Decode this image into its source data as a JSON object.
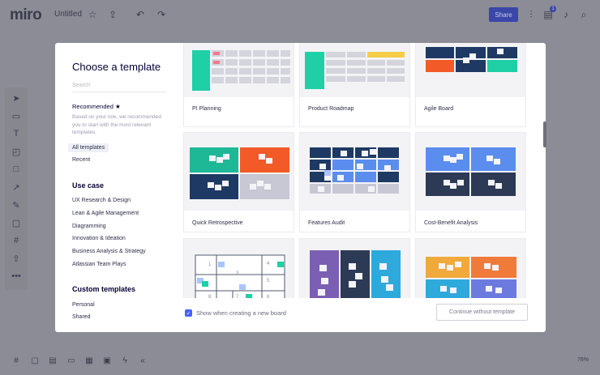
{
  "app": {
    "logo": "miro",
    "board_title": "Untitled",
    "share_label": "Share",
    "notification_count": "1",
    "zoom": "76%",
    "colors": {
      "accent": "#4262ff",
      "share_bg": "#3a47a8"
    }
  },
  "modal": {
    "title": "Choose a template",
    "search_placeholder": "Search",
    "recommended_label": "Recommended ★",
    "recommended_desc": "Based on your role, we recommended you to start with the most relevant templates.",
    "nav": [
      {
        "label": "All templates",
        "active": true
      },
      {
        "label": "Recent",
        "active": false
      }
    ],
    "use_case_heading": "Use case",
    "use_cases": [
      "UX Research & Design",
      "Lean & Agile Management",
      "Diagramming",
      "Innovation & Ideation",
      "Business Analysis & Strategy",
      "Atlassian Team Plays"
    ],
    "custom_heading": "Custom templates",
    "custom": [
      "Personal",
      "Shared"
    ],
    "templates": [
      {
        "label": "PI Planning"
      },
      {
        "label": "Product Roadmap"
      },
      {
        "label": "Agile Board"
      },
      {
        "label": "Quick Retrospective"
      },
      {
        "label": "Features Audit"
      },
      {
        "label": "Cost-Benefit Analysis"
      },
      {
        "label": ""
      },
      {
        "label": ""
      },
      {
        "label": ""
      }
    ],
    "grid_numbers": [
      "1",
      "3",
      "4",
      "5",
      "6",
      "7",
      "8"
    ],
    "show_on_create_label": "Show when creating a new board",
    "show_on_create_checked": true,
    "continue_label": "Continue without template"
  }
}
